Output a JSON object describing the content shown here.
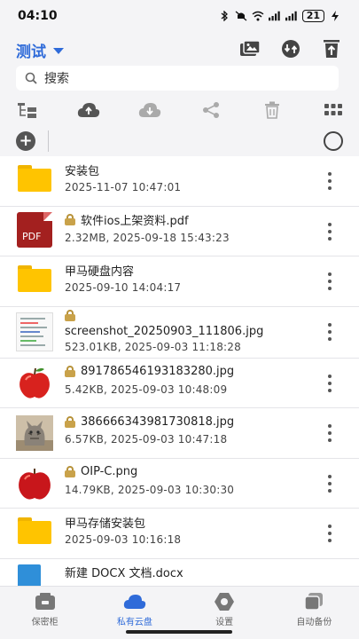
{
  "status": {
    "time": "04:10",
    "battery": "21"
  },
  "header": {
    "title": "测试"
  },
  "search": {
    "placeholder": "搜索"
  },
  "files": [
    {
      "name": "安装包",
      "meta": "2025-11-07 10:47:01",
      "type": "folder",
      "locked": false
    },
    {
      "name": "软件ios上架资料.pdf",
      "meta": "2.32MB, 2025-09-18 15:43:23",
      "type": "pdf",
      "locked": true,
      "thumb_label": "PDF"
    },
    {
      "name": "甲马硬盘内容",
      "meta": "2025-09-10 14:04:17",
      "type": "folder",
      "locked": false
    },
    {
      "name": "screenshot_20250903_111806.jpg",
      "meta": "523.01KB, 2025-09-03 11:18:28",
      "type": "screenshot",
      "locked": true
    },
    {
      "name": "891786546193183280.jpg",
      "meta": "5.42KB, 2025-09-03 10:48:09",
      "type": "apple",
      "locked": true
    },
    {
      "name": "386666343981730818.jpg",
      "meta": "6.57KB, 2025-09-03 10:47:18",
      "type": "cat",
      "locked": true
    },
    {
      "name": "OIP-C.png",
      "meta": "14.79KB, 2025-09-03 10:30:30",
      "type": "apple",
      "locked": true
    },
    {
      "name": "甲马存储安装包",
      "meta": "2025-09-03 10:16:18",
      "type": "folder",
      "locked": false
    },
    {
      "name": "新建 DOCX 文档.docx",
      "meta": "",
      "type": "docx",
      "locked": false
    }
  ],
  "nav": [
    {
      "label": "保密柜",
      "icon": "safe-icon",
      "active": false
    },
    {
      "label": "私有云盘",
      "icon": "cloud-icon",
      "active": true
    },
    {
      "label": "设置",
      "icon": "settings-icon",
      "active": false
    },
    {
      "label": "自动备份",
      "icon": "backup-icon",
      "active": false
    }
  ],
  "colors": {
    "accent": "#2f6bd9",
    "folder": "#ffc400",
    "lock": "#c9a24a"
  }
}
